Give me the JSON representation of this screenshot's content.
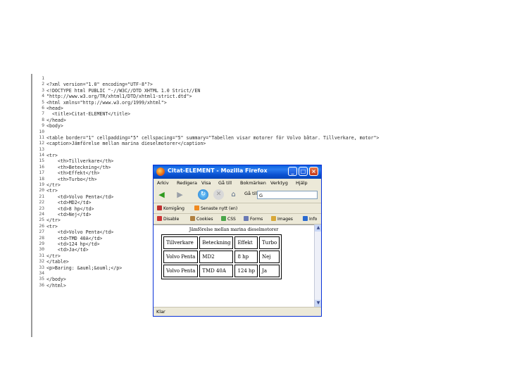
{
  "editor": {
    "line_numbers": [
      "1",
      "2",
      "3",
      "4",
      "5",
      "6",
      "7",
      "8",
      "9",
      "10",
      "11",
      "12",
      "13",
      "14",
      "15",
      "16",
      "17",
      "18",
      "19",
      "20",
      "21",
      "22",
      "23",
      "24",
      "25",
      "26",
      "27",
      "28",
      "29",
      "30",
      "31",
      "32",
      "33",
      "34",
      "35",
      "36"
    ],
    "lines": [
      "",
      "<?xml version=\"1.0\" encoding=\"UTF-8\"?>",
      "<!DOCTYPE html PUBLIC \"-//W3C//DTD XHTML 1.0 Strict//EN",
      "\"http://www.w3.org/TR/xhtml1/DTD/xhtml1-strict.dtd\">",
      "<html xmlns=\"http://www.w3.org/1999/xhtml\">",
      "<head>",
      "  <title>Citat-ELEMENT</title>",
      "</head>",
      "<body>",
      "",
      "<table border=\"1\" cellpadding=\"5\" cellspacing=\"5\" summary=\"Tabellen visar motorer för Volvo båtar. Tillverkare, motor\">",
      "<caption>Jämförelse mellan marina dieselmotorer</caption>",
      "",
      "<tr>",
      "    <th>Tillverkare</th>",
      "    <th>Beteckning</th>",
      "    <th>Effekt</th>",
      "    <th>Turbo</th>",
      "</tr>",
      "<tr>",
      "    <td>Volvo Penta</td>",
      "    <td>MD2</td>",
      "    <td>8 hp</td>",
      "    <td>Nej</td>",
      "</tr>",
      "<tr>",
      "    <td>Volvo Penta</td>",
      "    <td>TMD 40A</td>",
      "    <td>124 hp</td>",
      "    <td>Ja</td>",
      "</tr>",
      "</table>",
      "<p>Baring: &auml;&ouml;</p>",
      "",
      "</body>",
      "</html>"
    ]
  },
  "browser": {
    "title": "Citat-ELEMENT - Mozilla Firefox",
    "menu": [
      "Arkiv",
      "Redigera",
      "Visa",
      "Gå till",
      "Bokmärken",
      "Verktyg",
      "Hjälp"
    ],
    "go_label": "Gå till",
    "url_value": "G",
    "bookmarks": [
      "Komigång",
      "Senaste nytt (en)"
    ],
    "dev_toolbar": [
      "Disable",
      "Cookies",
      "CSS",
      "Forms",
      "Images",
      "Info"
    ],
    "caption": "Jämförelse mellan marina dieselmotorer",
    "table": {
      "header": [
        "Tillverkare",
        "Beteckning",
        "Effekt",
        "Turbo"
      ],
      "rows": [
        [
          "Volvo Penta",
          "MD2",
          "8 hp",
          "Nej"
        ],
        [
          "Volvo Penta",
          "TMD 40A",
          "124 hp",
          "Ja"
        ]
      ]
    },
    "status": "Klar"
  },
  "colors": {
    "titlebar": "#0a52d2",
    "window_chrome": "#ece9d8",
    "code_text": "#2a2a2a",
    "string_value": "#5b5fd6"
  }
}
